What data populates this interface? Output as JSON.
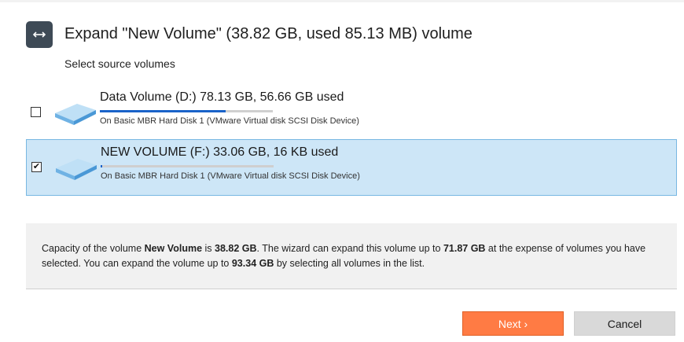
{
  "dialog": {
    "title": "Expand \"New Volume\" (38.82 GB, used 85.13 MB) volume",
    "subtitle": "Select source volumes",
    "header_icon": "expand-arrows-icon"
  },
  "volumes": [
    {
      "name": "Data Volume (D:) 78.13 GB, 56.66 GB used",
      "location": "On Basic MBR Hard Disk 1 (VMware Virtual disk SCSI Disk Device)",
      "checked": false,
      "check_mark": "",
      "usage_fraction": 0.725,
      "icon": "drive-icon"
    },
    {
      "name": "NEW VOLUME (F:) 33.06 GB, 16 KB used",
      "location": "On Basic MBR Hard Disk 1 (VMware Virtual disk SCSI Disk Device)",
      "checked": true,
      "check_mark": "✔",
      "usage_fraction": 0.0,
      "icon": "drive-icon"
    }
  ],
  "info": {
    "t1": "Capacity of the volume ",
    "volume_name": "New Volume",
    "t2": " is ",
    "capacity": "38.82 GB",
    "t3": ". The wizard can expand this volume up to ",
    "expand_to": "71.87 GB",
    "t4": " at the expense of volumes you have selected. You can expand the volume up to ",
    "max_expand": "93.34 GB",
    "t5": " by selecting all volumes in the list."
  },
  "buttons": {
    "next": "Next ›",
    "cancel": "Cancel"
  },
  "colors": {
    "accent": "#ff7b44",
    "selection": "#cde6f7",
    "usage_bar": "#1a63c9",
    "header_icon_bg": "#3e4a56"
  }
}
